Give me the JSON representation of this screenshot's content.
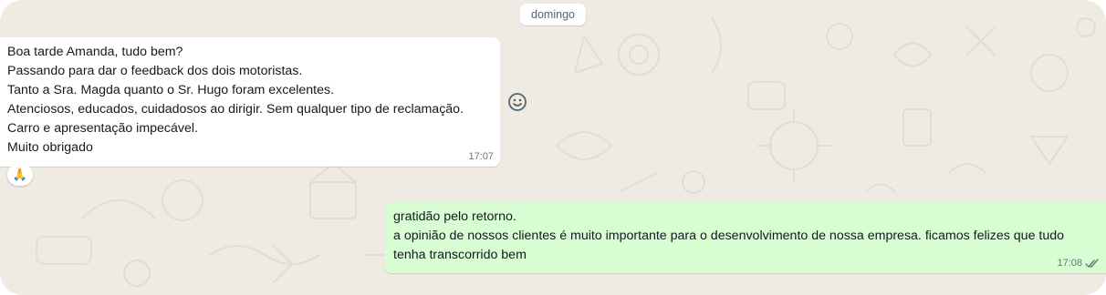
{
  "chat": {
    "date_divider": "domingo",
    "incoming_message": {
      "lines": [
        "Boa tarde Amanda, tudo bem?",
        "Passando para dar o feedback dos dois motoristas.",
        "Tanto a Sra. Magda quanto o Sr. Hugo foram excelentes.",
        "Atenciosos, educados, cuidadosos ao dirigir. Sem qualquer tipo de reclamação.",
        "Carro e apresentação impecável.",
        "Muito obrigado"
      ],
      "time": "17:07",
      "reaction_emoji": "🙏"
    },
    "outgoing_message": {
      "lines": [
        "gratidão pelo retorno.",
        "a opinião de nossos clientes é muito importante para o desenvolvimento de nossa empresa. ficamos felizes que tudo tenha transcorrido bem"
      ],
      "time": "17:08",
      "status_icon": "double-check-icon"
    },
    "icons": {
      "react": "smiley-icon"
    },
    "colors": {
      "background": "#efeae2",
      "incoming_bubble": "#ffffff",
      "outgoing_bubble": "#d9fdd3",
      "meta_text": "#667781"
    }
  }
}
